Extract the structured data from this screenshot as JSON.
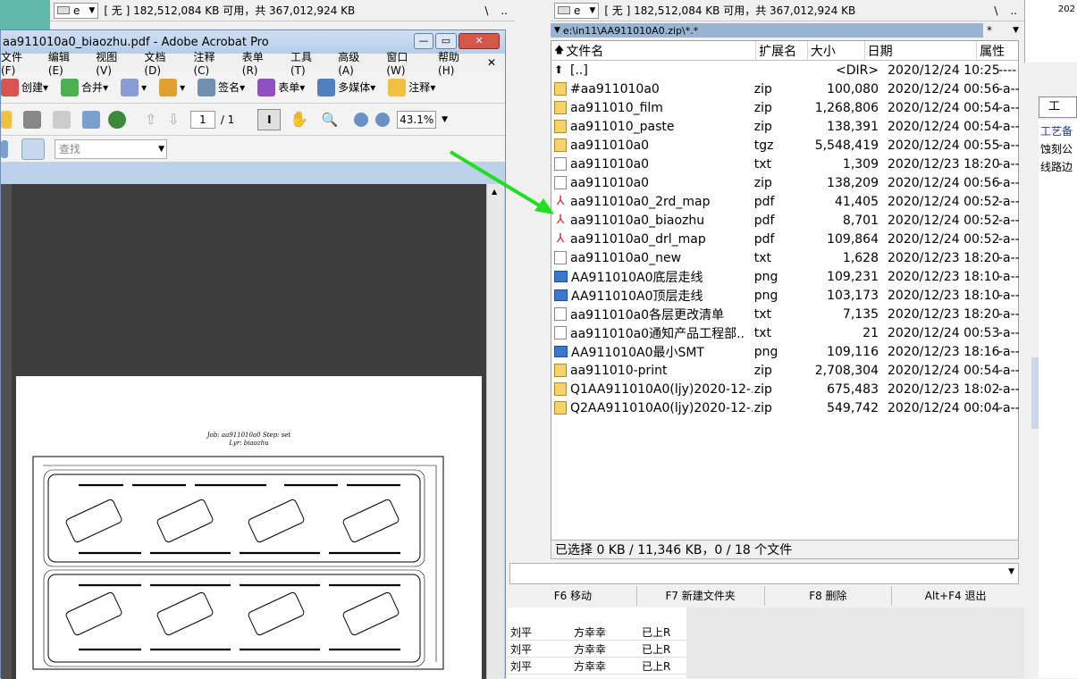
{
  "left_panel": {
    "drive": "e",
    "free_space": "[ 无 ]  182,512,084 KB 可用，共 367,012,924 KB",
    "nav_back": "\\",
    "nav_up": ".."
  },
  "right_panel": {
    "drive": "e",
    "free_space": "[ 无 ]  182,512,084 KB 可用，共 367,012,924 KB",
    "nav_back": "\\",
    "nav_up": "..",
    "path": "e:\\in11\\AA911010A0.zip\\*.*",
    "filter": "*"
  },
  "columns": {
    "name": "文件名",
    "ext": "扩展名",
    "size": "大小",
    "date": "日期",
    "attr": "属性"
  },
  "files": [
    {
      "name": "[..]",
      "ext": "",
      "size": "<DIR>",
      "date": "2020/12/24 10:25",
      "attr": "----",
      "type": "up"
    },
    {
      "name": "#aa911010a0",
      "ext": "zip",
      "size": "100,080",
      "date": "2020/12/24 00:56",
      "attr": "-a--",
      "type": "zip"
    },
    {
      "name": "aa911010_film",
      "ext": "zip",
      "size": "1,268,806",
      "date": "2020/12/24 00:54",
      "attr": "-a--",
      "type": "zip"
    },
    {
      "name": "aa911010_paste",
      "ext": "zip",
      "size": "138,391",
      "date": "2020/12/24 00:54",
      "attr": "-a--",
      "type": "zip"
    },
    {
      "name": "aa911010a0",
      "ext": "tgz",
      "size": "5,548,419",
      "date": "2020/12/24 00:55",
      "attr": "-a--",
      "type": "zip"
    },
    {
      "name": "aa911010a0",
      "ext": "txt",
      "size": "1,309",
      "date": "2020/12/23 18:20",
      "attr": "-a--",
      "type": "txt"
    },
    {
      "name": "aa911010a0",
      "ext": "zip",
      "size": "138,209",
      "date": "2020/12/24 00:56",
      "attr": "-a--",
      "type": "txt"
    },
    {
      "name": "aa911010a0_2rd_map",
      "ext": "pdf",
      "size": "41,405",
      "date": "2020/12/24 00:52",
      "attr": "-a--",
      "type": "pdf"
    },
    {
      "name": "aa911010a0_biaozhu",
      "ext": "pdf",
      "size": "8,701",
      "date": "2020/12/24 00:52",
      "attr": "-a--",
      "type": "pdf"
    },
    {
      "name": "aa911010a0_drl_map",
      "ext": "pdf",
      "size": "109,864",
      "date": "2020/12/24 00:52",
      "attr": "-a--",
      "type": "pdf"
    },
    {
      "name": "aa911010a0_new",
      "ext": "txt",
      "size": "1,628",
      "date": "2020/12/23 18:20",
      "attr": "-a--",
      "type": "txt"
    },
    {
      "name": "AA911010A0底层走线",
      "ext": "png",
      "size": "109,231",
      "date": "2020/12/23 18:10",
      "attr": "-a--",
      "type": "png"
    },
    {
      "name": "AA911010A0顶层走线",
      "ext": "png",
      "size": "103,173",
      "date": "2020/12/23 18:10",
      "attr": "-a--",
      "type": "png"
    },
    {
      "name": "aa911010a0各层更改清单",
      "ext": "txt",
      "size": "7,135",
      "date": "2020/12/23 18:20",
      "attr": "-a--",
      "type": "txt"
    },
    {
      "name": "aa911010a0通知产品工程部..",
      "ext": "txt",
      "size": "21",
      "date": "2020/12/24 00:53",
      "attr": "-a--",
      "type": "txt"
    },
    {
      "name": "AA911010A0最小SMT",
      "ext": "png",
      "size": "109,116",
      "date": "2020/12/23 18:16",
      "attr": "-a--",
      "type": "png"
    },
    {
      "name": "aa911010-print",
      "ext": "zip",
      "size": "2,708,304",
      "date": "2020/12/24 00:54",
      "attr": "-a--",
      "type": "zip"
    },
    {
      "name": "Q1AA911010A0(ljy)2020-12-..",
      "ext": "zip",
      "size": "675,483",
      "date": "2020/12/23 18:02",
      "attr": "-a--",
      "type": "zip"
    },
    {
      "name": "Q2AA911010A0(ljy)2020-12-..",
      "ext": "zip",
      "size": "549,742",
      "date": "2020/12/24 00:04",
      "attr": "-a--",
      "type": "zip"
    }
  ],
  "status": "已选择 0 KB / 11,346 KB，0 / 18 个文件",
  "fkeys": [
    "F6 移动",
    "F7 新建文件夹",
    "F8 删除",
    "Alt+F4 退出"
  ],
  "acrobat": {
    "title": "aa911010a0_biaozhu.pdf - Adobe Acrobat Pro",
    "menus": [
      "文件(F)",
      "编辑(E)",
      "视图(V)",
      "文档(D)",
      "注释(C)",
      "表单(R)",
      "工具(T)",
      "高级(A)",
      "窗口(W)",
      "帮助(H)"
    ],
    "toolbar": {
      "create": "创建",
      "combine": "合并",
      "sign": "签名",
      "forms": "表单",
      "multimedia": "多媒体",
      "comment": "注释"
    },
    "page_current": "1",
    "page_total": "/ 1",
    "zoom": "43.1%",
    "search_placeholder": "查找",
    "doc_job": "Job: aa911010a0  Step: set",
    "doc_layer": "Lyr: biaozhu"
  },
  "behind_table": [
    {
      "a": "刘平",
      "b": "方幸幸",
      "c": "已上R"
    },
    {
      "a": "刘平",
      "b": "方幸幸",
      "c": "已上R"
    },
    {
      "a": "刘平",
      "b": "方幸幸",
      "c": "已上R"
    }
  ],
  "right_edge": {
    "year": "202",
    "tab": "工",
    "text1": "工艺备",
    "text2": "蚀刻公",
    "text3": "线路边"
  }
}
